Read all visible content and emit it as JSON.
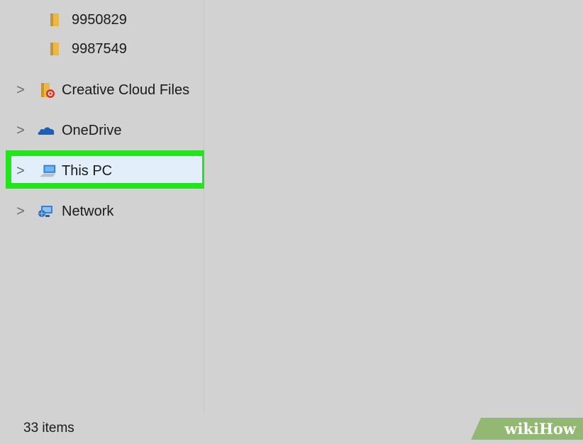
{
  "sidebar": {
    "items": [
      {
        "label": "9950829",
        "icon": "folder-icon"
      },
      {
        "label": "9987549",
        "icon": "folder-icon"
      },
      {
        "label": "Creative Cloud Files",
        "icon": "creative-cloud-folder-icon"
      },
      {
        "label": "OneDrive",
        "icon": "onedrive-cloud-icon"
      },
      {
        "label": "This PC",
        "icon": "computer-icon",
        "selected": true
      },
      {
        "label": "Network",
        "icon": "network-icon"
      }
    ],
    "expand_glyph": ">"
  },
  "status": {
    "item_count": "33 items"
  },
  "watermark": {
    "text": "wikiHow"
  },
  "colors": {
    "highlight_border": "#22e61b",
    "selection_fill": "#e2eef9",
    "background": "#d2d2d2"
  }
}
